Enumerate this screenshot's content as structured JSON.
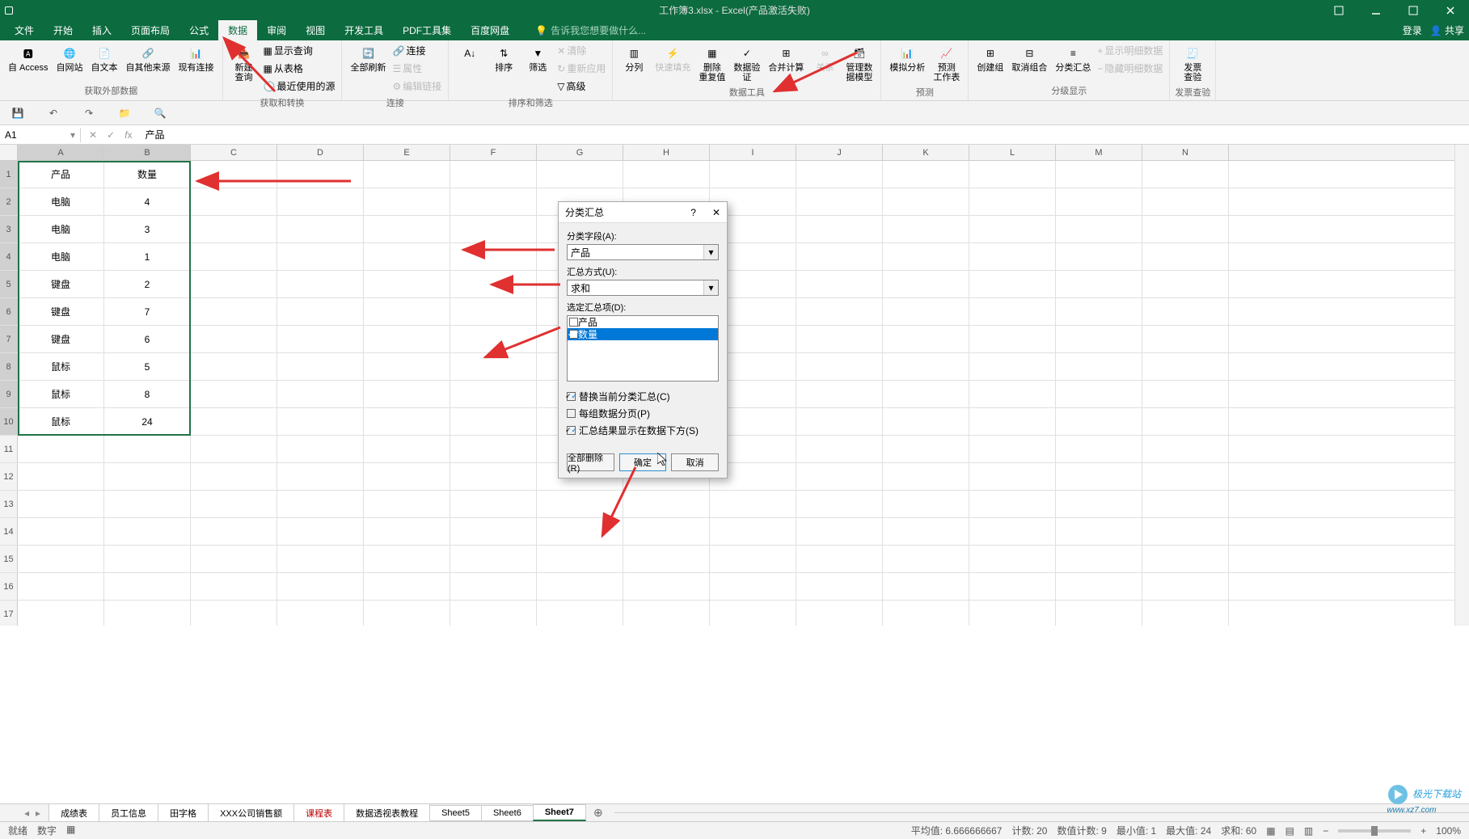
{
  "titlebar": {
    "title": "工作簿3.xlsx - Excel(产品激活失败)",
    "login": "登录",
    "share": "共享"
  },
  "menu": {
    "file": "文件",
    "home": "开始",
    "insert": "插入",
    "layout": "页面布局",
    "formulas": "公式",
    "data": "数据",
    "review": "审阅",
    "view": "视图",
    "dev": "开发工具",
    "pdf": "PDF工具集",
    "baidu": "百度网盘",
    "tellme_ph": "告诉我您想要做什么..."
  },
  "ribbon": {
    "g1": {
      "access": "自 Access",
      "web": "自网站",
      "text": "自文本",
      "other": "自其他来源",
      "existing": "现有连接",
      "label": "获取外部数据"
    },
    "g2": {
      "newquery": "新建\n查询",
      "showquery": "显示查询",
      "fromtable": "从表格",
      "recent": "最近使用的源",
      "label": "获取和转换"
    },
    "g3": {
      "refresh": "全部刷新",
      "conn": "连接",
      "prop": "属性",
      "editlink": "编辑链接",
      "label": "连接"
    },
    "g4": {
      "sort": "排序",
      "filter": "筛选",
      "clear": "清除",
      "reapply": "重新应用",
      "advanced": "高级",
      "label": "排序和筛选"
    },
    "g5": {
      "split": "分列",
      "flash": "快速填充",
      "removedup": "删除\n重复值",
      "validate": "数据验\n证",
      "consolidate": "合并计算",
      "relation": "关系",
      "manage": "管理数\n据模型",
      "label": "数据工具"
    },
    "g6": {
      "whatif": "模拟分析",
      "forecast": "预测\n工作表",
      "label": "预测"
    },
    "g7": {
      "group": "创建组",
      "ungroup": "取消组合",
      "subtotal": "分类汇总",
      "showdetail": "显示明细数据",
      "hidedetail": "隐藏明细数据",
      "label": "分级显示"
    },
    "g8": {
      "invoice": "发票\n查验",
      "label": "发票查验"
    }
  },
  "namebox": {
    "value": "A1"
  },
  "formulabar": {
    "value": "产品"
  },
  "columns": [
    "A",
    "B",
    "C",
    "D",
    "E",
    "F",
    "G",
    "H",
    "I",
    "J",
    "K",
    "L",
    "M",
    "N"
  ],
  "rownums": [
    1,
    2,
    3,
    4,
    5,
    6,
    7,
    8,
    9,
    10,
    11,
    12,
    13,
    14,
    15,
    16,
    17
  ],
  "table": {
    "headers": [
      "产品",
      "数量"
    ],
    "rows": [
      [
        "电脑",
        "4"
      ],
      [
        "电脑",
        "3"
      ],
      [
        "电脑",
        "1"
      ],
      [
        "键盘",
        "2"
      ],
      [
        "键盘",
        "7"
      ],
      [
        "键盘",
        "6"
      ],
      [
        "鼠标",
        "5"
      ],
      [
        "鼠标",
        "8"
      ],
      [
        "鼠标",
        "24"
      ]
    ]
  },
  "dialog": {
    "title": "分类汇总",
    "help": "?",
    "field_label": "分类字段(A):",
    "field_value": "产品",
    "func_label": "汇总方式(U):",
    "func_value": "求和",
    "items_label": "选定汇总项(D):",
    "item1": "产品",
    "item2": "数量",
    "cb1": "替换当前分类汇总(C)",
    "cb2": "每组数据分页(P)",
    "cb3": "汇总结果显示在数据下方(S)",
    "btn_remove": "全部删除(R)",
    "btn_ok": "确定",
    "btn_cancel": "取消"
  },
  "sheets": {
    "nav_back": "◂",
    "nav_fwd": "▸",
    "tabs": [
      "成绩表",
      "员工信息",
      "田字格",
      "XXX公司销售额",
      "课程表",
      "数据透视表教程",
      "Sheet5",
      "Sheet6",
      "Sheet7"
    ],
    "active": "Sheet7"
  },
  "status": {
    "ready": "就绪",
    "numlock": "数字",
    "avg": "平均值: 6.666666667",
    "count": "计数: 20",
    "numcount": "数值计数: 9",
    "min": "最小值: 1",
    "max": "最大值: 24",
    "sum": "求和: 60",
    "zoom": "100%"
  },
  "watermark": {
    "name": "极光下载站",
    "url": "www.xz7.com"
  }
}
